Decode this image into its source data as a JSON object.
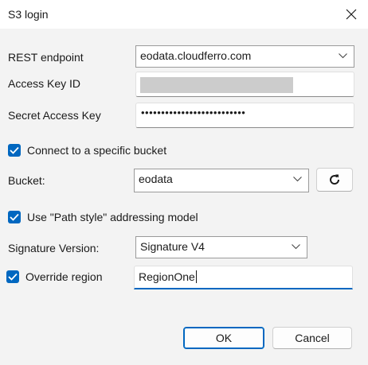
{
  "window": {
    "title": "S3 login"
  },
  "form": {
    "rest_endpoint": {
      "label": "REST endpoint",
      "value": "eodata.cloudferro.com"
    },
    "access_key_id": {
      "label": "Access Key ID",
      "value_masked": true
    },
    "secret_access_key": {
      "label": "Secret Access Key",
      "value": "••••••••••••••••••••••••••"
    },
    "connect_specific_bucket": {
      "label": "Connect to a specific bucket",
      "checked": true
    },
    "bucket": {
      "label": "Bucket:",
      "value": "eodata"
    },
    "path_style": {
      "label": "Use \"Path style\" addressing model",
      "checked": true
    },
    "signature_version": {
      "label": "Signature Version:",
      "value": "Signature V4"
    },
    "override_region": {
      "label": "Override region",
      "checked": true,
      "value": "RegionOne"
    }
  },
  "buttons": {
    "ok": "OK",
    "cancel": "Cancel"
  },
  "icons": {
    "close": "close-icon",
    "chevron": "chevron-down-icon",
    "refresh": "refresh-icon",
    "check": "check-icon"
  },
  "colors": {
    "accent": "#0067c0",
    "dialog_background": "#f3f3f3",
    "masked_field": "#cccccc"
  }
}
